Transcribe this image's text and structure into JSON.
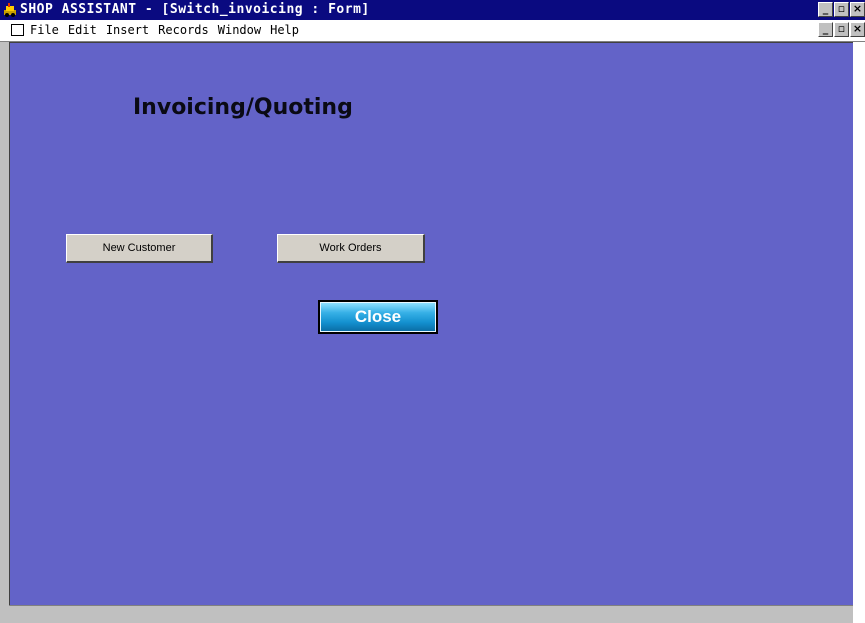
{
  "window": {
    "title": "SHOP ASSISTANT - [Switch_invoicing : Form]",
    "controls": {
      "minimize": "_",
      "restore": "▫",
      "close": "×"
    }
  },
  "menubar": {
    "items": [
      "File",
      "Edit",
      "Insert",
      "Records",
      "Window",
      "Help"
    ],
    "controls": {
      "minimize": "_",
      "restore": "▫",
      "close": "×"
    }
  },
  "form": {
    "title": "Invoicing/Quoting",
    "buttons": {
      "new_customer": "New Customer",
      "work_orders": "Work Orders",
      "close": "Close"
    }
  },
  "colors": {
    "titlebar": "#0a0a80",
    "form_background": "#6363c8",
    "close_button": "#1390cf"
  }
}
